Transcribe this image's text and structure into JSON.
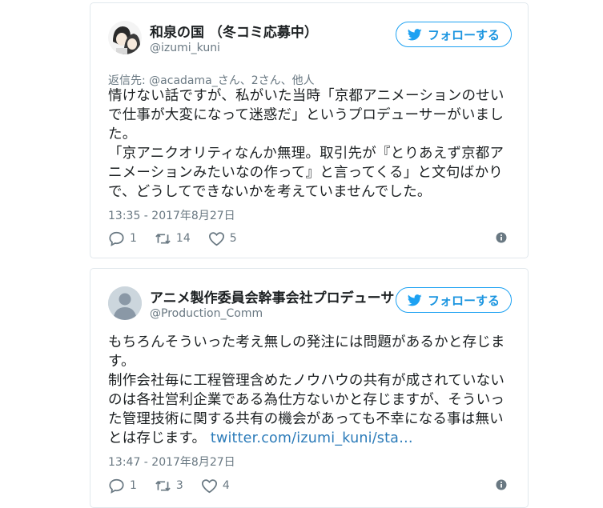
{
  "colors": {
    "accent": "#1da1f2",
    "link": "#2b7bb9",
    "muted": "#697882",
    "border": "#e1e8ed"
  },
  "tweets": [
    {
      "author_name": "和泉の国 （冬コミ応募中）",
      "handle": "@izumi_kuni",
      "follow_label": "フォローする",
      "reply_to": "返信先: @acadama_さん、2さん、他人",
      "text_lines": [
        "情けない話ですが、私がいた当時「京都アニメーションのせい",
        "で仕事が大変になって迷惑だ」というプロデューサーがいまし",
        "た。",
        "「京アニクオリティなんか無理。取引先が『とりあえず京都ア",
        "ニメーションみたいなの作って』と言ってくる」と文句ばかり",
        "で、どうしてできないかを考えていませんでした。"
      ],
      "timestamp": "13:35 - 2017年8月27日",
      "replies": "1",
      "retweets": "14",
      "likes": "5",
      "avatar_icon": "anime-avatar-icon"
    },
    {
      "author_name": "アニメ製作委員会幹事会社プロデューサ",
      "handle": "@Production_Comm",
      "follow_label": "フォローする",
      "text_lines": [
        "もちろんそういった考え無しの発注には問題があるかと存じま",
        "す。",
        "制作会社毎に工程管理含めたノウハウの共有が成されていない",
        "のは各社営利企業である為仕方ないかと存じますが、そういっ",
        "た管理技術に関する共有の機会があっても不幸になる事は無い"
      ],
      "last_line_text": "とは存じます。 ",
      "link_text": "twitter.com/izumi_kuni/sta…",
      "timestamp": "13:47 - 2017年8月27日",
      "replies": "1",
      "retweets": "3",
      "likes": "4",
      "avatar_icon": "default-avatar-icon"
    }
  ]
}
